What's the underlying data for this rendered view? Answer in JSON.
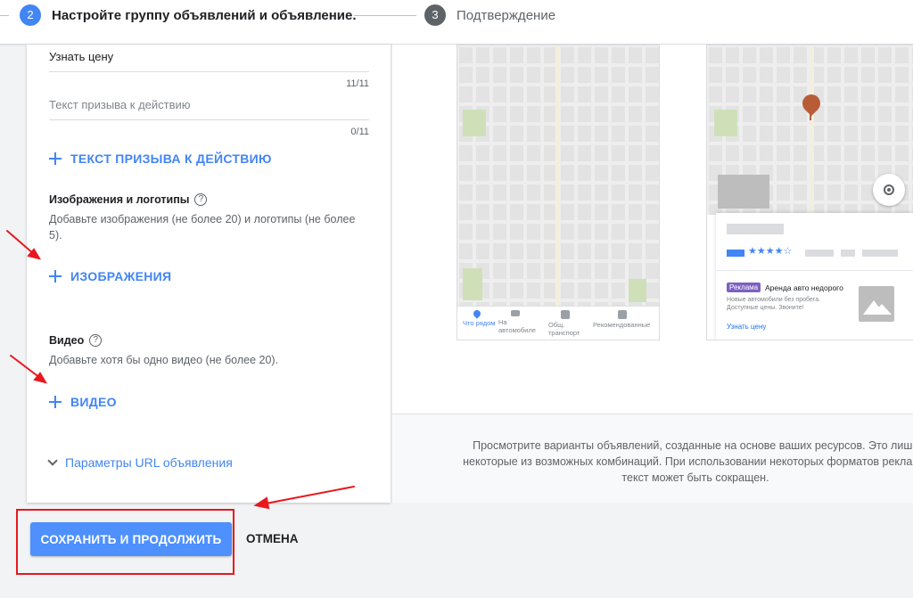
{
  "stepper": {
    "active_step_number": "2",
    "active_step_title": "Настройте группу объявлений и объявление.",
    "next_step_number": "3",
    "next_step_title": "Подтверждение"
  },
  "form": {
    "cta_value": "Узнать цену",
    "cta_value_count": "11/11",
    "cta_placeholder": "Текст призыва к действию",
    "cta_placeholder_count": "0/11",
    "add_cta_label": "ТЕКСТ ПРИЗЫВА К ДЕЙСТВИЮ",
    "images_title": "Изображения и логотипы",
    "images_desc": "Добавьте изображения (не более 20) и логотипы (не более 5).",
    "add_images_label": "ИЗОБРАЖЕНИЯ",
    "video_title": "Видео",
    "video_desc": "Добавьте хотя бы одно видео (не более 20).",
    "add_video_label": "ВИДЕО",
    "url_params_label": "Параметры URL объявления",
    "help_glyph": "?"
  },
  "preview": {
    "nav_items": [
      {
        "label": "Что рядом",
        "icon": "place-icon"
      },
      {
        "label": "На автомобиле",
        "icon": "car-icon"
      },
      {
        "label": "Общ. транспорт",
        "icon": "transit-icon"
      },
      {
        "label": "Рекомендованные",
        "icon": "plus-box-icon"
      }
    ],
    "stars": "★★★★☆",
    "ad_badge": "Реклама",
    "ad_title": "Аренда авто недорого",
    "ad_description": "Новые автомобили без пробега. Доступные цены. Звоните!",
    "ad_link": "Узнать цену",
    "footer_text_line1": "Просмотрите варианты объявлений, созданные на основе ваших ресурсов. Это лишь",
    "footer_text_line2": "некоторые из возможных комбинаций. При использовании некоторых форматов рекламы",
    "footer_text_line3": "текст может быть сокращен."
  },
  "actions": {
    "save_label": "СОХРАНИТЬ И ПРОДОЛЖИТЬ",
    "cancel_label": "ОТМЕНА"
  },
  "colors": {
    "accent": "#4285f4",
    "annotation_red": "#e8181e",
    "ad_badge": "#7b61c1",
    "pin": "#b85c38"
  }
}
